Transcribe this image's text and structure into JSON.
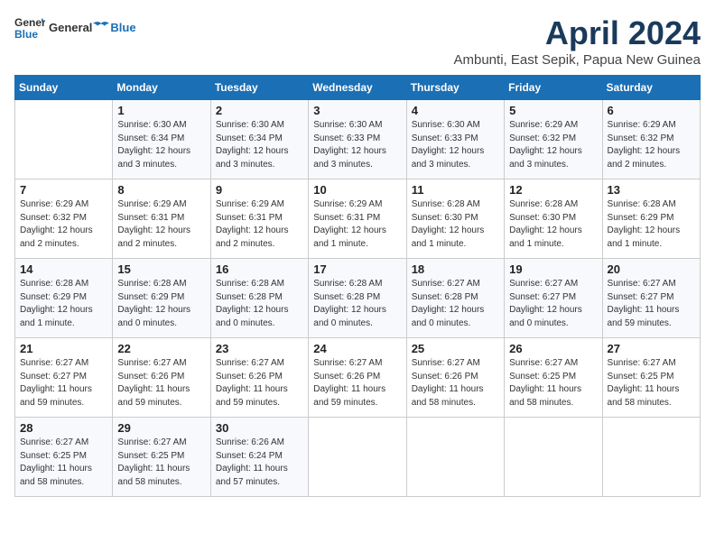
{
  "logo": {
    "text_general": "General",
    "text_blue": "Blue"
  },
  "header": {
    "month_title": "April 2024",
    "subtitle": "Ambunti, East Sepik, Papua New Guinea"
  },
  "days_of_week": [
    "Sunday",
    "Monday",
    "Tuesday",
    "Wednesday",
    "Thursday",
    "Friday",
    "Saturday"
  ],
  "weeks": [
    [
      {
        "num": "",
        "info": ""
      },
      {
        "num": "1",
        "info": "Sunrise: 6:30 AM\nSunset: 6:34 PM\nDaylight: 12 hours\nand 3 minutes."
      },
      {
        "num": "2",
        "info": "Sunrise: 6:30 AM\nSunset: 6:34 PM\nDaylight: 12 hours\nand 3 minutes."
      },
      {
        "num": "3",
        "info": "Sunrise: 6:30 AM\nSunset: 6:33 PM\nDaylight: 12 hours\nand 3 minutes."
      },
      {
        "num": "4",
        "info": "Sunrise: 6:30 AM\nSunset: 6:33 PM\nDaylight: 12 hours\nand 3 minutes."
      },
      {
        "num": "5",
        "info": "Sunrise: 6:29 AM\nSunset: 6:32 PM\nDaylight: 12 hours\nand 3 minutes."
      },
      {
        "num": "6",
        "info": "Sunrise: 6:29 AM\nSunset: 6:32 PM\nDaylight: 12 hours\nand 2 minutes."
      }
    ],
    [
      {
        "num": "7",
        "info": "Sunrise: 6:29 AM\nSunset: 6:32 PM\nDaylight: 12 hours\nand 2 minutes."
      },
      {
        "num": "8",
        "info": "Sunrise: 6:29 AM\nSunset: 6:31 PM\nDaylight: 12 hours\nand 2 minutes."
      },
      {
        "num": "9",
        "info": "Sunrise: 6:29 AM\nSunset: 6:31 PM\nDaylight: 12 hours\nand 2 minutes."
      },
      {
        "num": "10",
        "info": "Sunrise: 6:29 AM\nSunset: 6:31 PM\nDaylight: 12 hours\nand 1 minute."
      },
      {
        "num": "11",
        "info": "Sunrise: 6:28 AM\nSunset: 6:30 PM\nDaylight: 12 hours\nand 1 minute."
      },
      {
        "num": "12",
        "info": "Sunrise: 6:28 AM\nSunset: 6:30 PM\nDaylight: 12 hours\nand 1 minute."
      },
      {
        "num": "13",
        "info": "Sunrise: 6:28 AM\nSunset: 6:29 PM\nDaylight: 12 hours\nand 1 minute."
      }
    ],
    [
      {
        "num": "14",
        "info": "Sunrise: 6:28 AM\nSunset: 6:29 PM\nDaylight: 12 hours\nand 1 minute."
      },
      {
        "num": "15",
        "info": "Sunrise: 6:28 AM\nSunset: 6:29 PM\nDaylight: 12 hours\nand 0 minutes."
      },
      {
        "num": "16",
        "info": "Sunrise: 6:28 AM\nSunset: 6:28 PM\nDaylight: 12 hours\nand 0 minutes."
      },
      {
        "num": "17",
        "info": "Sunrise: 6:28 AM\nSunset: 6:28 PM\nDaylight: 12 hours\nand 0 minutes."
      },
      {
        "num": "18",
        "info": "Sunrise: 6:27 AM\nSunset: 6:28 PM\nDaylight: 12 hours\nand 0 minutes."
      },
      {
        "num": "19",
        "info": "Sunrise: 6:27 AM\nSunset: 6:27 PM\nDaylight: 12 hours\nand 0 minutes."
      },
      {
        "num": "20",
        "info": "Sunrise: 6:27 AM\nSunset: 6:27 PM\nDaylight: 11 hours\nand 59 minutes."
      }
    ],
    [
      {
        "num": "21",
        "info": "Sunrise: 6:27 AM\nSunset: 6:27 PM\nDaylight: 11 hours\nand 59 minutes."
      },
      {
        "num": "22",
        "info": "Sunrise: 6:27 AM\nSunset: 6:26 PM\nDaylight: 11 hours\nand 59 minutes."
      },
      {
        "num": "23",
        "info": "Sunrise: 6:27 AM\nSunset: 6:26 PM\nDaylight: 11 hours\nand 59 minutes."
      },
      {
        "num": "24",
        "info": "Sunrise: 6:27 AM\nSunset: 6:26 PM\nDaylight: 11 hours\nand 59 minutes."
      },
      {
        "num": "25",
        "info": "Sunrise: 6:27 AM\nSunset: 6:26 PM\nDaylight: 11 hours\nand 58 minutes."
      },
      {
        "num": "26",
        "info": "Sunrise: 6:27 AM\nSunset: 6:25 PM\nDaylight: 11 hours\nand 58 minutes."
      },
      {
        "num": "27",
        "info": "Sunrise: 6:27 AM\nSunset: 6:25 PM\nDaylight: 11 hours\nand 58 minutes."
      }
    ],
    [
      {
        "num": "28",
        "info": "Sunrise: 6:27 AM\nSunset: 6:25 PM\nDaylight: 11 hours\nand 58 minutes."
      },
      {
        "num": "29",
        "info": "Sunrise: 6:27 AM\nSunset: 6:25 PM\nDaylight: 11 hours\nand 58 minutes."
      },
      {
        "num": "30",
        "info": "Sunrise: 6:26 AM\nSunset: 6:24 PM\nDaylight: 11 hours\nand 57 minutes."
      },
      {
        "num": "",
        "info": ""
      },
      {
        "num": "",
        "info": ""
      },
      {
        "num": "",
        "info": ""
      },
      {
        "num": "",
        "info": ""
      }
    ]
  ]
}
